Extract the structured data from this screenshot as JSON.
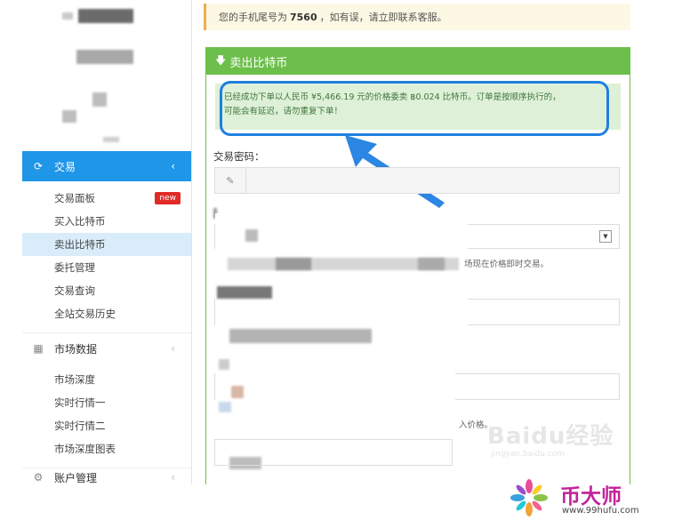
{
  "sidebar": {
    "trade_section": {
      "label": "交易",
      "icon": "refresh-icon",
      "chevron": "‹"
    },
    "trade_items": [
      {
        "label": "交易面板",
        "badge": "new"
      },
      {
        "label": "买入比特币"
      },
      {
        "label": "卖出比特币",
        "selected": true
      },
      {
        "label": "委托管理"
      },
      {
        "label": "交易查询"
      },
      {
        "label": "全站交易历史"
      }
    ],
    "market_section": {
      "label": "市场数据",
      "icon": "chart-icon",
      "chevron": "‹"
    },
    "market_items": [
      {
        "label": "市场深度"
      },
      {
        "label": "实时行情一"
      },
      {
        "label": "实时行情二"
      },
      {
        "label": "市场深度图表"
      }
    ],
    "account_section": {
      "label": "账户管理",
      "icon": "gear-icon",
      "chevron": "‹"
    }
  },
  "notice": {
    "prefix": "您的手机尾号为",
    "phone_tail": "7560",
    "suffix": "，如有误，请立即联系客服。"
  },
  "panel": {
    "title": "卖出比特币",
    "success_line1": "已经成功下单以人民币 ¥5,466.19 元的价格委卖 ฿0.024 比特币。订单是按顺序执行的，",
    "success_line2": "可能会有延迟，请勿重复下单！",
    "password_label": "交易密码：",
    "partial_hint_1": "场现在价格即时交易。",
    "partial_hint_2": "入价格。"
  },
  "watermark": {
    "text": "Baidu经验",
    "sub": "jingyan.baidu.com"
  },
  "footer": {
    "brand": "币大师",
    "url": "www.99hufu.com"
  },
  "colors": {
    "accent_blue": "#1f96e8",
    "panel_green": "#6dbf4b",
    "badge_red": "#e02b27",
    "brand_magenta": "#c1239a"
  }
}
